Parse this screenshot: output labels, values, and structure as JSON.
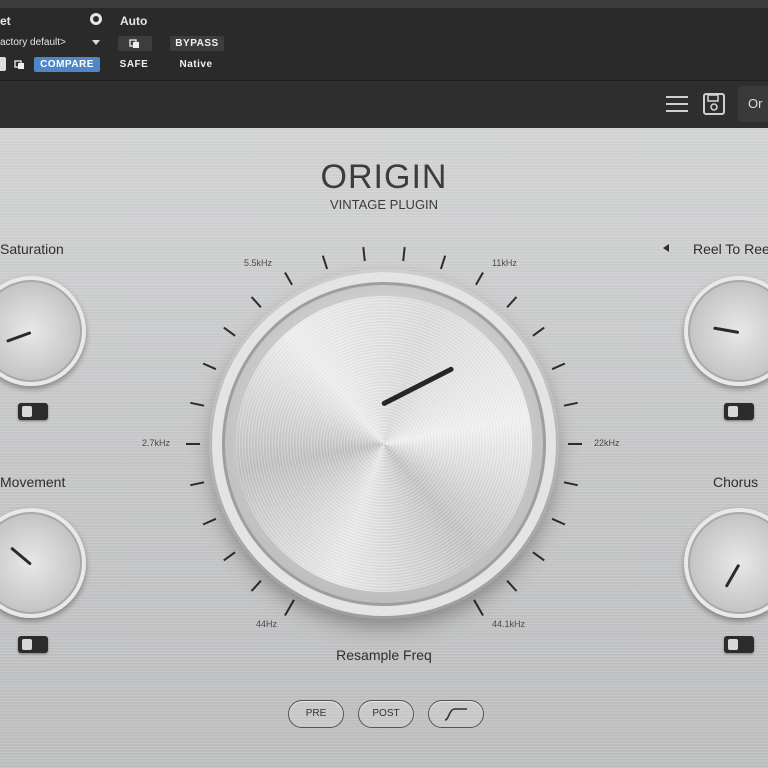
{
  "host": {
    "preset_label": "et",
    "auto_label": "Auto",
    "preset_value": "actory default>",
    "bypass_label": "BYPASS",
    "compare_label": "COMPARE",
    "safe_label": "SAFE",
    "native_label": "Native",
    "compare_active": true
  },
  "header": {
    "preset_name": "Or",
    "icons": [
      "menu-icon",
      "save-icon"
    ]
  },
  "brand": {
    "title": "ORIGIN",
    "subtitle": "VINTAGE PLUGIN"
  },
  "controls": {
    "saturation": {
      "label": "Saturation"
    },
    "movement": {
      "label": "Movement"
    },
    "reel_to_reel": {
      "label": "Reel To Ree"
    },
    "chorus": {
      "label": "Chorus"
    },
    "resample": {
      "label": "Resample Freq",
      "ticks": {
        "t1": "5.5kHz",
        "t2": "11kHz",
        "t3": "2.7kHz",
        "t4": "22kHz",
        "t5": "44Hz",
        "t6": "44.1kHz"
      }
    }
  },
  "buttons": {
    "pre": "PRE",
    "post": "POST"
  },
  "colors": {
    "accent": "#4f86c6",
    "panel": "#c8c9ca",
    "host_bar": "#2a2a2a"
  }
}
